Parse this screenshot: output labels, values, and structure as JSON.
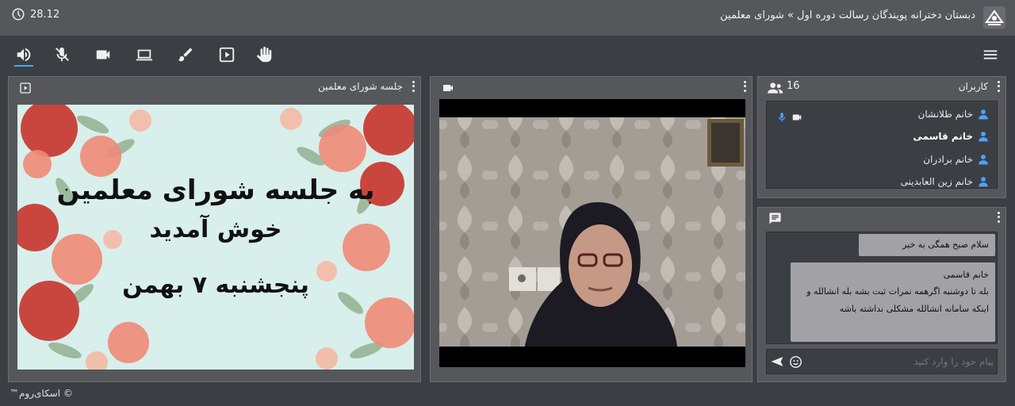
{
  "header": {
    "timer": "28.12",
    "title": "دبستان دخترانه پویندگان رسالت دوره اول » شورای معلمین"
  },
  "toolbar": {
    "icons": [
      "speaker-icon",
      "mic-off-icon",
      "camera-icon",
      "screen-share-icon",
      "brush-icon",
      "play-icon",
      "hand-icon",
      "menu-icon"
    ]
  },
  "presentation": {
    "title": "جلسه شورای معلمین",
    "slide": {
      "line1": "به جلسه شورای معلمین",
      "line2": "خوش آمدید",
      "line3": "پنجشنبه ۷ بهمن"
    }
  },
  "users": {
    "title": "کاربران",
    "count": "16",
    "list": [
      {
        "name": "خانم طلانشان"
      },
      {
        "name": "خانم قاسمی"
      },
      {
        "name": "خانم برادران"
      },
      {
        "name": "خانم زین العابدینی"
      }
    ]
  },
  "chat": {
    "messages": [
      {
        "text": "سلام صبح همگی به خیر"
      },
      {
        "sender": "خانم قاسمی",
        "text": "بله تا دوشنبه اگرهمه نمرات ثبت بشه بله انشالله و اینکه سامانه انشالله مشکلی نداشته باشه"
      }
    ],
    "placeholder": "پیام خود را وارد کنید"
  },
  "footer": {
    "brand": "© اسکای‌روم™"
  },
  "colors": {
    "accent": "#4ba3ff",
    "panel": "#56575b",
    "background": "#3b3f44"
  }
}
